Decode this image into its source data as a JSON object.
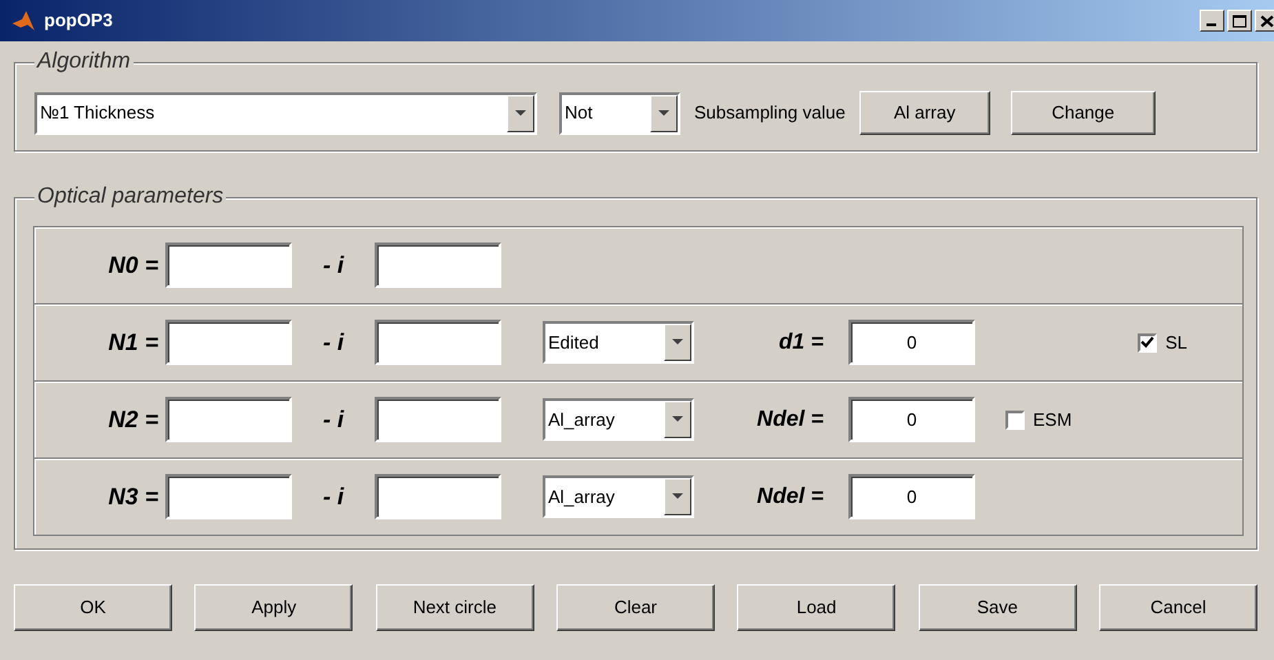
{
  "window": {
    "title": "popOP3"
  },
  "algorithm": {
    "legend": "Algorithm",
    "method": "№1 Thickness",
    "subsampling": "Not",
    "subsampling_label": "Subsampling value",
    "buttons": [
      "Al array",
      "Change"
    ]
  },
  "optical": {
    "legend": "Optical parameters",
    "rows": [
      {
        "label": "N0 =",
        "imag_label": "- i"
      },
      {
        "label": "N1 =",
        "imag_label": "- i",
        "mode": "Edited",
        "param_label": "d1 =",
        "param_value": "0",
        "option": {
          "label": "SL",
          "checked": true
        }
      },
      {
        "label": "N2 =",
        "imag_label": "- i",
        "mode": "Al_array",
        "param_label": "Ndel =",
        "param_value": "0",
        "option": {
          "label": "ESM",
          "checked": false
        }
      },
      {
        "label": "N3 =",
        "imag_label": "- i",
        "mode": "Al_array",
        "param_label": "Ndel =",
        "param_value": "0"
      }
    ]
  },
  "buttons": [
    "OK",
    "Apply",
    "Next circle",
    "Clear",
    "Load",
    "Save",
    "Cancel"
  ]
}
